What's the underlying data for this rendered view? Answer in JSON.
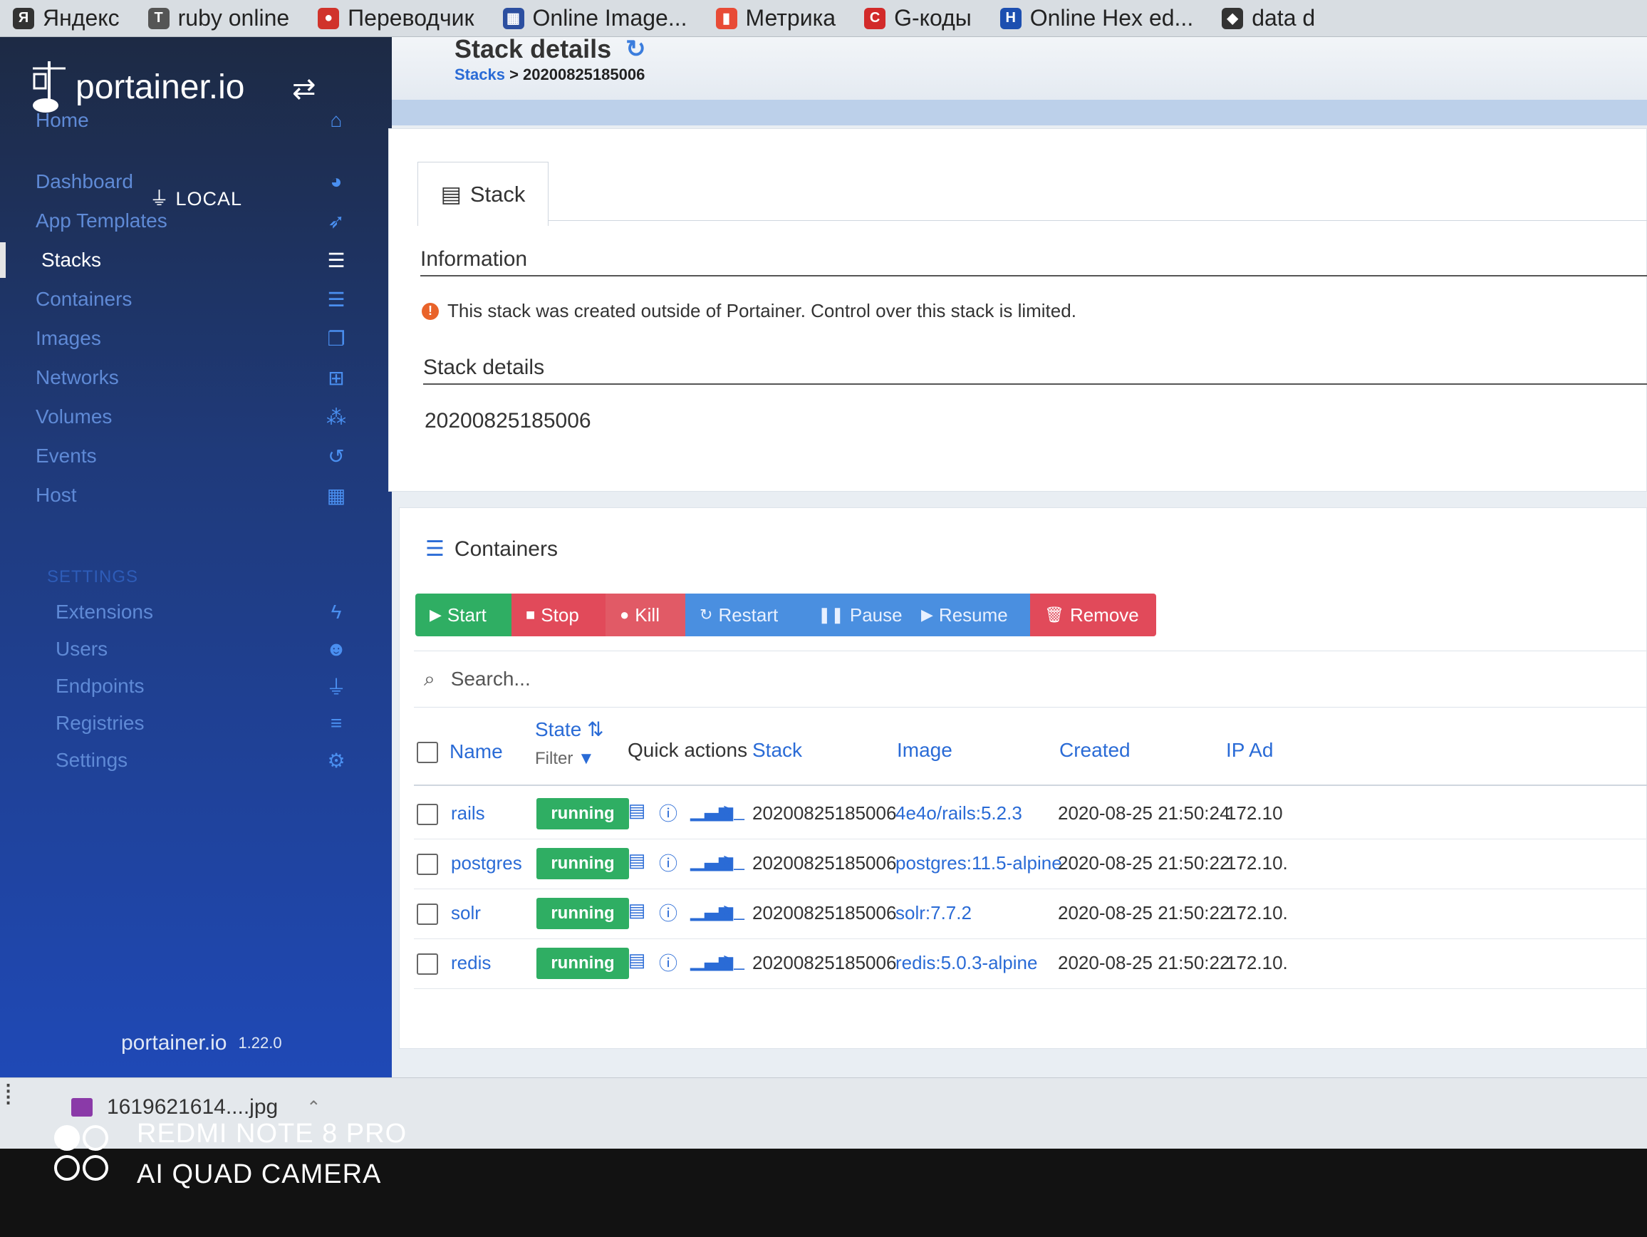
{
  "bookmarks": [
    {
      "label": "Яндекс",
      "icon": "yandex-icon",
      "color": "#333333",
      "glyph": "Я"
    },
    {
      "label": "ruby online",
      "icon": "text-icon",
      "color": "#555555",
      "glyph": "T"
    },
    {
      "label": "Переводчик",
      "icon": "translator-icon",
      "color": "#d0332b",
      "glyph": "●"
    },
    {
      "label": "Online Image...",
      "icon": "image-grid-icon",
      "color": "#2c4fa0",
      "glyph": "▦"
    },
    {
      "label": "Метрика",
      "icon": "metrika-icon",
      "color": "#e84b36",
      "glyph": "▮"
    },
    {
      "label": "G-коды",
      "icon": "gcodes-icon",
      "color": "#d22a2a",
      "glyph": "C"
    },
    {
      "label": "Online Hex ed...",
      "icon": "hex-editor-icon",
      "color": "#1d4fb0",
      "glyph": "H"
    },
    {
      "label": "data d",
      "icon": "data-icon",
      "color": "#333333",
      "glyph": "◆"
    }
  ],
  "sidebar": {
    "brand": "portainer.io",
    "home": "Home",
    "endpoint": "LOCAL",
    "items": [
      {
        "label": "Dashboard",
        "icon": "dashboard-icon",
        "glyph": "◕"
      },
      {
        "label": "App Templates",
        "icon": "rocket-icon",
        "glyph": "➶"
      },
      {
        "label": "Stacks",
        "icon": "list-icon",
        "glyph": "☰"
      },
      {
        "label": "Containers",
        "icon": "server-icon",
        "glyph": "☰"
      },
      {
        "label": "Images",
        "icon": "clone-icon",
        "glyph": "❐"
      },
      {
        "label": "Networks",
        "icon": "sitemap-icon",
        "glyph": "⊞"
      },
      {
        "label": "Volumes",
        "icon": "cubes-icon",
        "glyph": "⁂"
      },
      {
        "label": "Events",
        "icon": "history-icon",
        "glyph": "↺"
      },
      {
        "label": "Host",
        "icon": "th-icon",
        "glyph": "▦"
      }
    ],
    "settings_heading": "SETTINGS",
    "settings_items": [
      {
        "label": "Extensions",
        "icon": "bolt-icon",
        "glyph": "ϟ"
      },
      {
        "label": "Users",
        "icon": "users-icon",
        "glyph": "☻"
      },
      {
        "label": "Endpoints",
        "icon": "plug-icon",
        "glyph": "⏚"
      },
      {
        "label": "Registries",
        "icon": "database-icon",
        "glyph": "≡"
      },
      {
        "label": "Settings",
        "icon": "cogs-icon",
        "glyph": "⚙"
      }
    ],
    "footer_brand": "portainer.io",
    "version": "1.22.0",
    "active_item": "Stacks"
  },
  "header": {
    "title": "Stack details",
    "breadcrumb_link": "Stacks",
    "breadcrumb_sep": " > ",
    "breadcrumb_current": "20200825185006"
  },
  "stack_panel": {
    "tab_label": "Stack",
    "information_title": "Information",
    "warning": "This stack was created outside of Portainer. Control over this stack is limited.",
    "details_title": "Stack details",
    "stack_name": "20200825185006"
  },
  "containers": {
    "title": "Containers",
    "actions": {
      "start": "Start",
      "stop": "Stop",
      "kill": "Kill",
      "restart": "Restart",
      "pause": "Pause",
      "resume": "Resume",
      "remove": "Remove"
    },
    "search_placeholder": "Search...",
    "columns": {
      "name": "Name",
      "state": "State",
      "state_filter": "Filter",
      "quick_actions": "Quick actions",
      "stack": "Stack",
      "image": "Image",
      "created": "Created",
      "ip": "IP Ad"
    },
    "rows": [
      {
        "name": "rails",
        "state": "running",
        "stack": "20200825185006",
        "image": "4e4o/rails:5.2.3",
        "created": "2020-08-25 21:50:24",
        "ip": "172.10"
      },
      {
        "name": "postgres",
        "state": "running",
        "stack": "20200825185006",
        "image": "postgres:11.5-alpine",
        "created": "2020-08-25 21:50:22",
        "ip": "172.10."
      },
      {
        "name": "solr",
        "state": "running",
        "stack": "20200825185006",
        "image": "solr:7.7.2",
        "created": "2020-08-25 21:50:22",
        "ip": "172.10."
      },
      {
        "name": "redis",
        "state": "running",
        "stack": "20200825185006",
        "image": "redis:5.0.3-alpine",
        "created": "2020-08-25 21:50:22",
        "ip": "172.10."
      }
    ]
  },
  "download_bar": {
    "file": "1619621614....jpg"
  },
  "watermark": {
    "line1": "REDMI NOTE 8 PRO",
    "line2": "AI QUAD CAMERA"
  },
  "colors": {
    "accent": "#2a6bd6",
    "running": "#2fae63",
    "danger": "#e14a5a",
    "sidebar": "#1f49b6"
  }
}
